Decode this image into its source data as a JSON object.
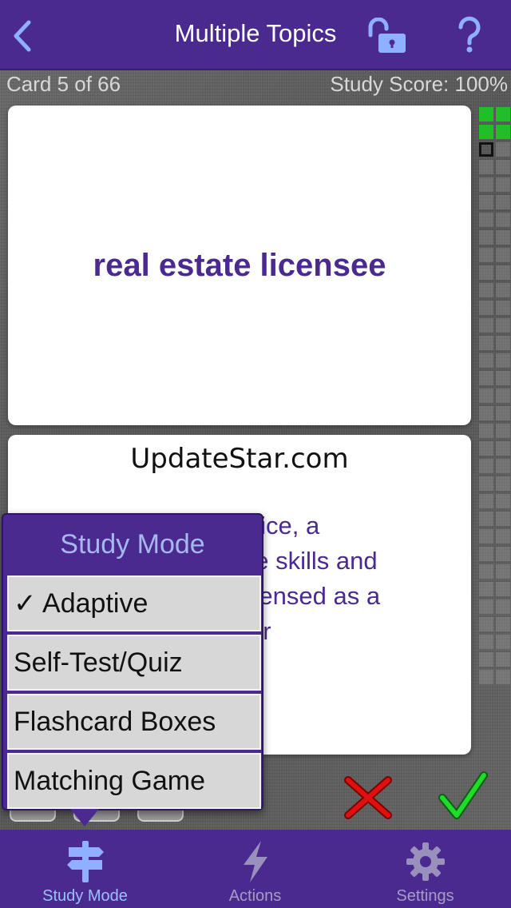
{
  "header": {
    "title": "Multiple Topics",
    "back_icon": "chevron-left-icon",
    "lock_icon": "unlocked-padlock-icon",
    "help_label": "?"
  },
  "status": {
    "card_counter": "Card 5 of 66",
    "study_score": "Study Score: 100%"
  },
  "progress": {
    "total": 66,
    "completed": 4,
    "current": 5
  },
  "card_front": {
    "term": "real estate licensee"
  },
  "card_back": {
    "watermark": "UpdateStar.com",
    "definition_visible": "ctice, a\nhe skills and\nicensed as a\n or"
  },
  "actions": {
    "wrong_icon": "red-x-icon",
    "right_icon": "green-check-icon"
  },
  "study_mode_menu": {
    "title": "Study Mode",
    "items": [
      {
        "label": "✓ Adaptive"
      },
      {
        "label": "Self-Test/Quiz"
      },
      {
        "label": "Flashcard Boxes"
      },
      {
        "label": "Matching Game"
      }
    ]
  },
  "tabbar": {
    "tabs": [
      {
        "label": "Study Mode",
        "icon": "signpost-icon"
      },
      {
        "label": "Actions",
        "icon": "lightning-icon"
      },
      {
        "label": "Settings",
        "icon": "gear-icon"
      }
    ]
  },
  "colors": {
    "brand_purple": "#4b2a90",
    "success_green": "#1fbf2a",
    "error_red": "#e01010"
  }
}
